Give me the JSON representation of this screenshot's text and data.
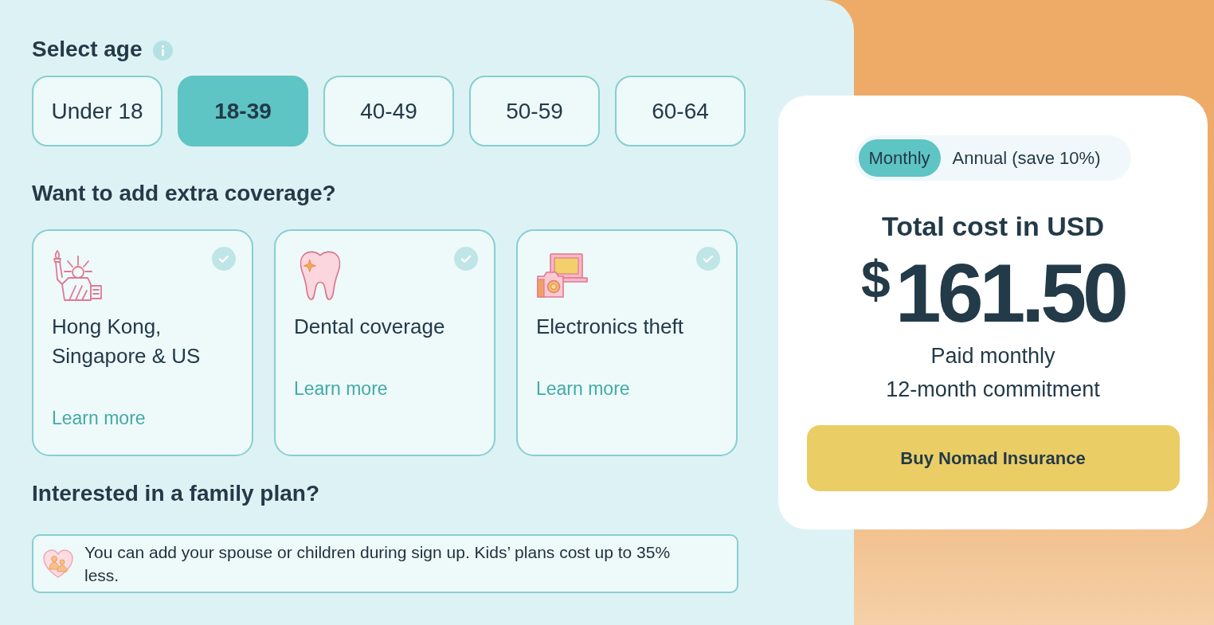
{
  "age_selector": {
    "label": "Select age",
    "options": [
      {
        "label": "Under 18",
        "selected": false
      },
      {
        "label": "18-39",
        "selected": true
      },
      {
        "label": "40-49",
        "selected": false
      },
      {
        "label": "50-59",
        "selected": false
      },
      {
        "label": "60-64",
        "selected": false
      }
    ]
  },
  "extra_coverage": {
    "heading": "Want to add extra coverage?",
    "options": [
      {
        "title": "Hong Kong, Singapore & US",
        "link": "Learn more",
        "checked": false
      },
      {
        "title": "Dental coverage",
        "link": "Learn more",
        "checked": false
      },
      {
        "title": "Electronics theft",
        "link": "Learn more",
        "checked": false
      }
    ]
  },
  "family_plan": {
    "heading": "Interested in a family plan?",
    "note": "You can add your spouse or children during sign up. Kids’ plans cost up to 35% less."
  },
  "price_card": {
    "billing_options": [
      {
        "label": "Monthly",
        "selected": true
      },
      {
        "label": "Annual (save 10%)",
        "selected": false
      }
    ],
    "title": "Total cost in USD",
    "currency": "$",
    "amount": "161.50",
    "details": [
      "Paid monthly",
      "12-month commitment"
    ],
    "button": "Buy Nomad Insurance"
  }
}
